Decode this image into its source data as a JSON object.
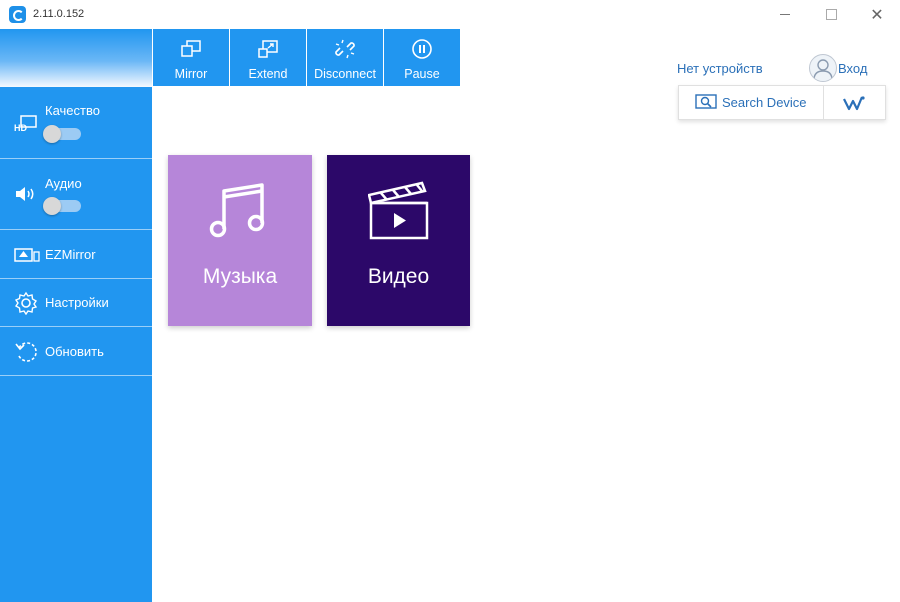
{
  "window": {
    "version": "2.11.0.152"
  },
  "toolbar": {
    "buttons": [
      {
        "label": "Mirror",
        "icon": "mirror-icon"
      },
      {
        "label": "Extend",
        "icon": "extend-icon"
      },
      {
        "label": "Disconnect",
        "icon": "disconnect-icon"
      },
      {
        "label": "Pause",
        "icon": "pause-icon"
      }
    ]
  },
  "sidebar": {
    "items": [
      {
        "label": "Качество",
        "icon": "hd-icon",
        "toggle": false
      },
      {
        "label": "Аудио",
        "icon": "speaker-icon",
        "toggle": false
      },
      {
        "label": "EZMirror",
        "icon": "ezmirror-icon"
      },
      {
        "label": "Настройки",
        "icon": "gear-icon"
      },
      {
        "label": "Обновить",
        "icon": "refresh-icon"
      }
    ]
  },
  "header": {
    "status": "Нет устройств",
    "login": "Вход",
    "search_label": "Search Device"
  },
  "tiles": [
    {
      "label": "Музыка",
      "icon": "music-note-icon",
      "color": "#b686d9"
    },
    {
      "label": "Видео",
      "icon": "clapperboard-icon",
      "color": "#2c0869"
    }
  ],
  "colors": {
    "accent": "#2196f0",
    "link": "#2b70b8"
  }
}
